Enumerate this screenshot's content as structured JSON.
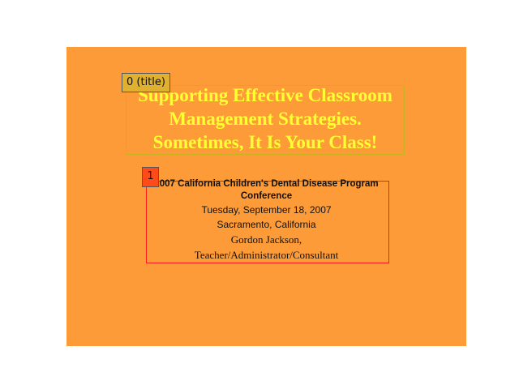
{
  "slide": {
    "background_color": "#fd9b38",
    "title": {
      "tag_label": "0 (title)",
      "lines": [
        "Supporting Effective Classroom",
        "Management Strategies.",
        "Sometimes, It Is Your Class!"
      ],
      "color": "#ffff33"
    },
    "body": {
      "tag_label": "1",
      "conference_lines": [
        "2007 California Children's Dental Disease Program",
        "Conference"
      ],
      "date": "Tuesday, September 18, 2007",
      "location": "Sacramento, California",
      "presenter_name": "Gordon Jackson,",
      "presenter_role": "Teacher/Administrator/Consultant"
    }
  }
}
